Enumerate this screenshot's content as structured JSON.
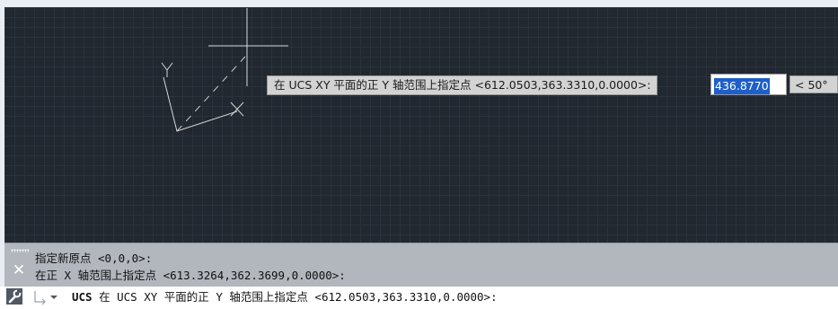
{
  "dynamic_input": {
    "prompt": "在 UCS XY 平面的正 Y 轴范围上指定点 <612.0503,363.3310,0.0000>:",
    "value": "436.8770",
    "angle": "< 50°"
  },
  "canvas": {
    "ucs_icon": {
      "x_label": "X",
      "y_label": "Y"
    }
  },
  "command_history": {
    "lines": [
      "指定新原点 <0,0,0>:",
      "在正 X 轴范围上指定点 <613.3264,362.3699,0.0000>:"
    ]
  },
  "command_line": {
    "command": "UCS",
    "prompt": " 在 UCS XY 平面的正 Y 轴范围上指定点 <612.0503,363.3310,0.0000>:"
  },
  "colors": {
    "canvas_background": "#212830",
    "command_history_background": "#b2b7be",
    "selection_highlight": "#1e5fc9"
  },
  "icons": {
    "close": "close-icon",
    "customize": "wrench-icon",
    "recent": "command-recent-icon",
    "grip": "grip-icon"
  }
}
